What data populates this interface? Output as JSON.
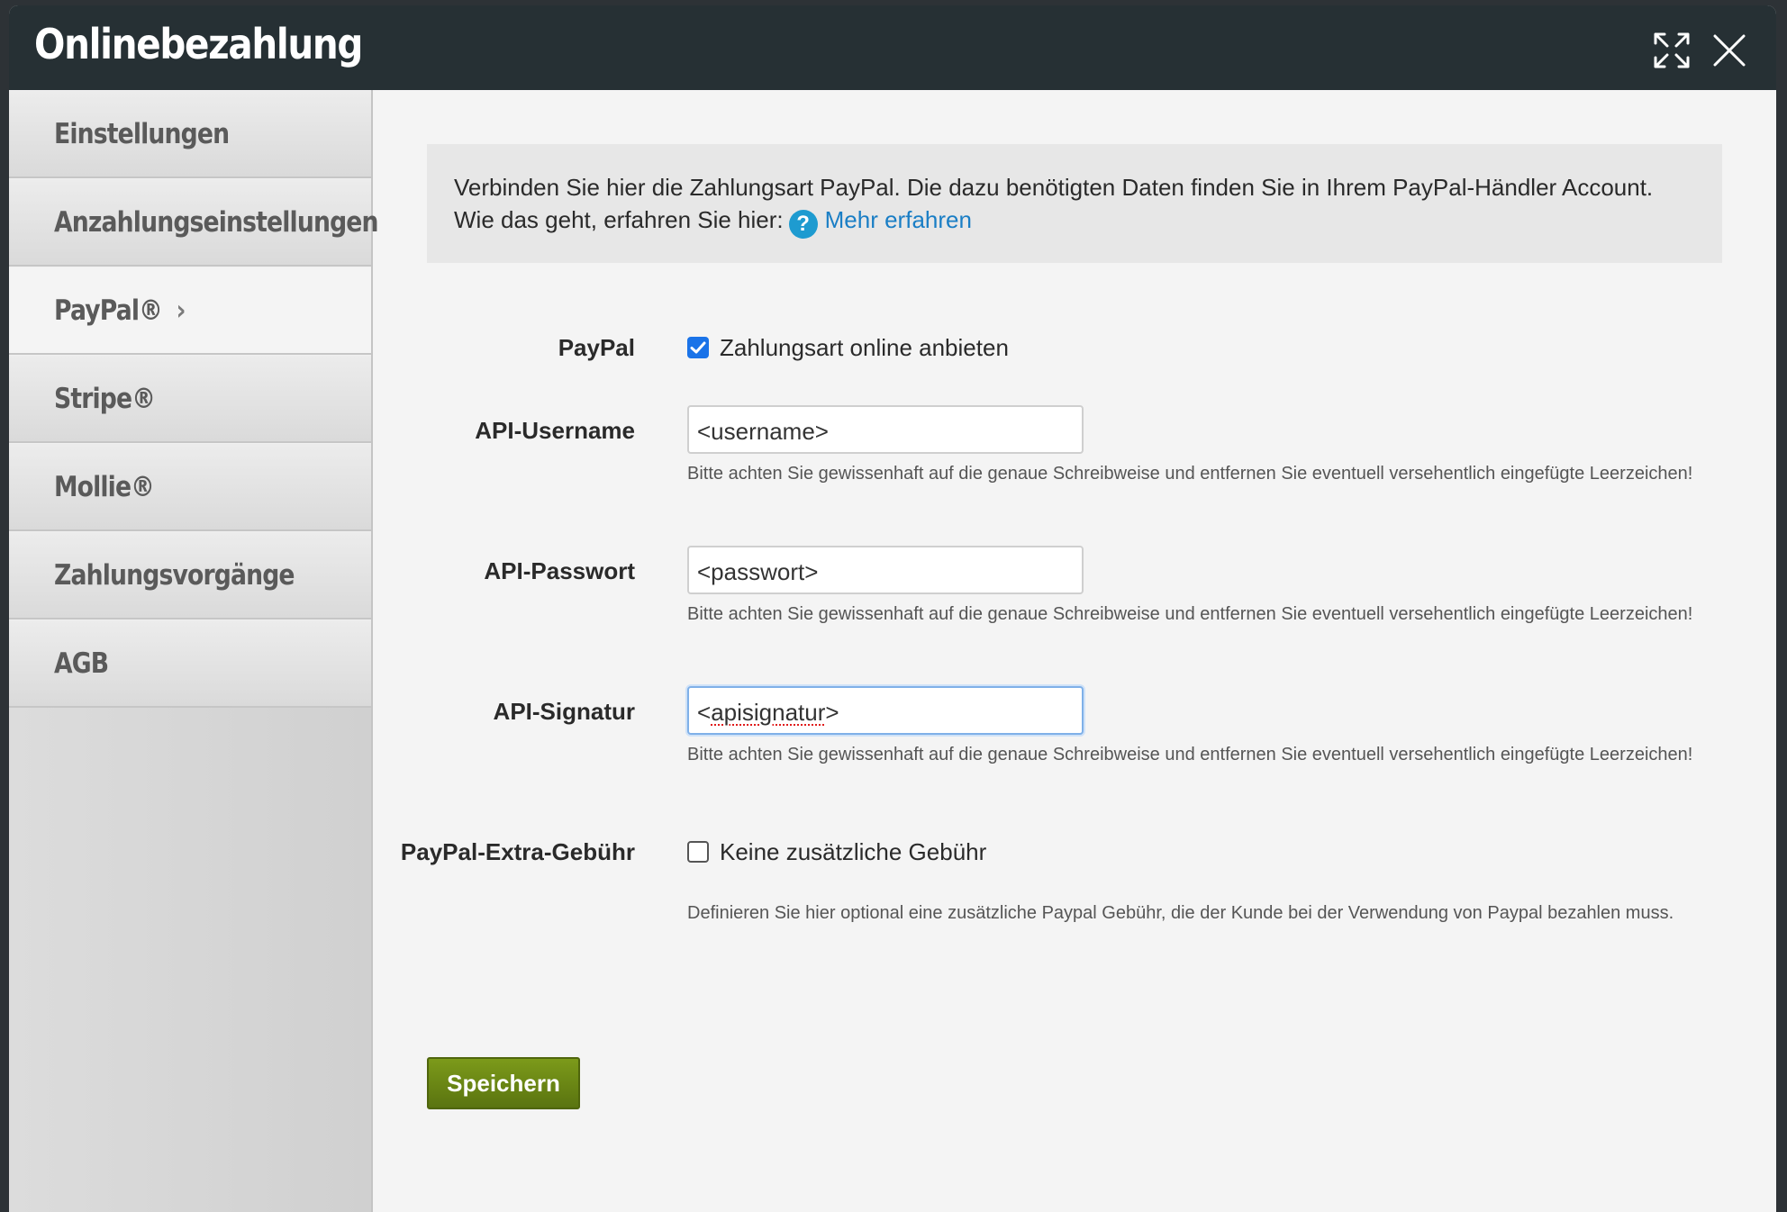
{
  "window": {
    "title": "Onlinebezahlung"
  },
  "sidebar": {
    "items": [
      {
        "label": "Einstellungen"
      },
      {
        "label": "Anzahlungseinstellungen"
      },
      {
        "label": "PayPal®",
        "chevron": "›"
      },
      {
        "label": "Stripe®"
      },
      {
        "label": "Mollie®"
      },
      {
        "label": "Zahlungsvorgänge"
      },
      {
        "label": "AGB"
      }
    ],
    "active_index": 2
  },
  "info": {
    "line1": "Verbinden Sie hier die Zahlungsart PayPal. Die dazu benötigten Daten finden Sie in Ihrem PayPal-Händler Account.",
    "line2": "Wie das geht, erfahren Sie hier:",
    "help_icon": "?",
    "link": "Mehr erfahren"
  },
  "form": {
    "paypal": {
      "label": "PayPal",
      "checkbox_label": "Zahlungsart online anbieten",
      "checked": true
    },
    "api_username": {
      "label": "API-Username",
      "value": "<username>",
      "hint": "Bitte achten Sie gewissenhaft auf die genaue Schreibweise und entfernen Sie eventuell versehentlich eingefügte Leerzeichen!"
    },
    "api_password": {
      "label": "API-Passwort",
      "value": "<passwort>",
      "hint": "Bitte achten Sie gewissenhaft auf die genaue Schreibweise und entfernen Sie eventuell versehentlich eingefügte Leerzeichen!"
    },
    "api_signature": {
      "label": "API-Signatur",
      "value_prefix": "<",
      "value_word": "apisignatur",
      "value_suffix": ">",
      "hint": "Bitte achten Sie gewissenhaft auf die genaue Schreibweise und entfernen Sie eventuell versehentlich eingefügte Leerzeichen!"
    },
    "extra_fee": {
      "label": "PayPal-Extra-Gebühr",
      "checkbox_label": "Keine zusätzliche Gebühr",
      "checked": false,
      "hint": "Definieren Sie hier optional eine zusätzliche Paypal Gebühr, die der Kunde bei der Verwendung von Paypal bezahlen muss."
    }
  },
  "actions": {
    "save_label": "Speichern"
  },
  "colors": {
    "titlebar": "#263034",
    "accent_blue": "#1a73e8",
    "link": "#1a7ec5",
    "save_green": "#6a8716"
  }
}
